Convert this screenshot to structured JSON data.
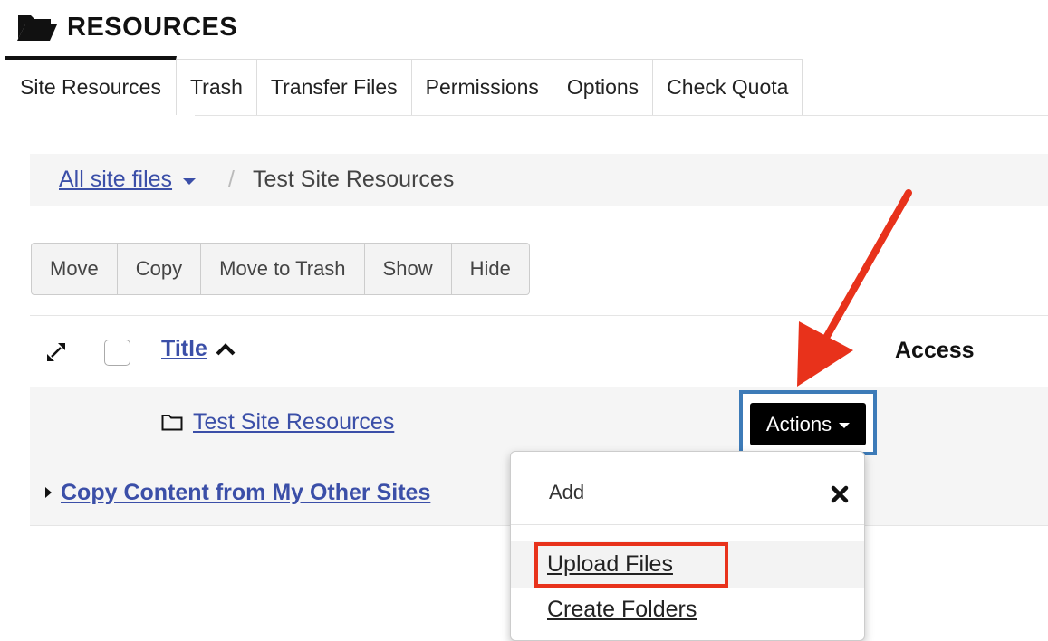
{
  "header": {
    "title": "RESOURCES",
    "icon": "folder-open-icon"
  },
  "tabs": [
    {
      "label": "Site Resources",
      "active": true
    },
    {
      "label": "Trash"
    },
    {
      "label": "Transfer Files"
    },
    {
      "label": "Permissions"
    },
    {
      "label": "Options"
    },
    {
      "label": "Check Quota"
    }
  ],
  "breadcrumb": {
    "root": "All site files",
    "separator": "/",
    "current": "Test Site Resources"
  },
  "toolbar": {
    "buttons": [
      "Move",
      "Copy",
      "Move to Trash",
      "Show",
      "Hide"
    ]
  },
  "table": {
    "columns": {
      "title": "Title",
      "access": "Access"
    },
    "rows": [
      {
        "title": "Test Site Resources",
        "actions_label": "Actions"
      }
    ],
    "copy_content_label": "Copy Content from My Other Sites"
  },
  "dropdown": {
    "header": "Add",
    "items": [
      "Upload Files",
      "Create Folders"
    ],
    "highlighted": "Upload Files"
  },
  "colors": {
    "link": "#3b4fa8",
    "annotation": "#e8321b",
    "focus": "#3d7bb8"
  }
}
